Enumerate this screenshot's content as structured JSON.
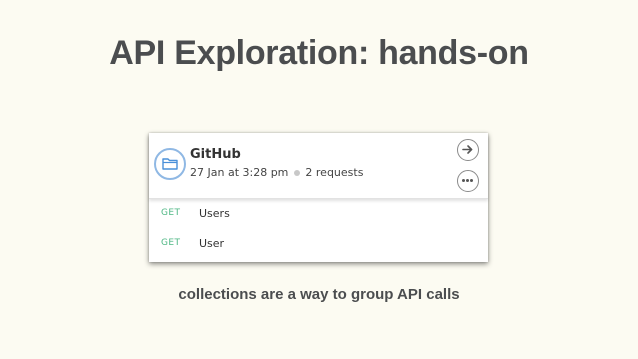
{
  "slide": {
    "title": "API Exploration: hands-on",
    "caption": "collections are a way to group API calls"
  },
  "collection": {
    "name": "GitHub",
    "date": "27 Jan at 3:28 pm",
    "request_count": "2 requests",
    "icon": "folder-icon",
    "actions": [
      {
        "icon": "arrow-right-icon"
      },
      {
        "icon": "more-options-icon"
      }
    ],
    "requests": [
      {
        "method": "GET",
        "name": "Users"
      },
      {
        "method": "GET",
        "name": "User"
      }
    ]
  },
  "colors": {
    "background": "#fcfbf2",
    "title_text": "#4b4d4f",
    "method_get": "#4fb784",
    "folder_accent": "#4a90d9"
  }
}
